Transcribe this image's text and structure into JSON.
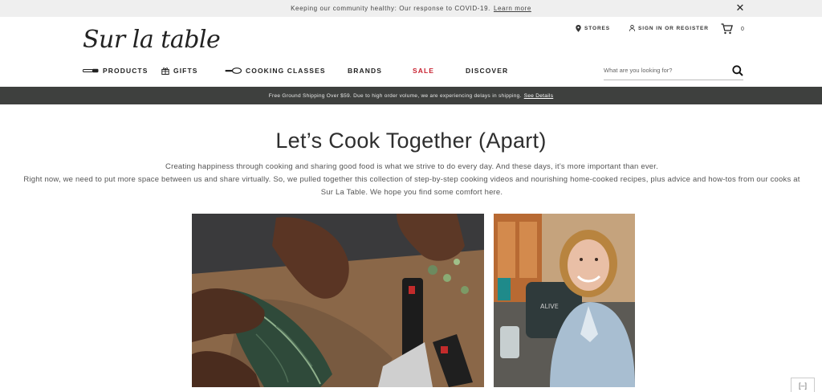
{
  "banner": {
    "text": "Keeping our community healthy: Our response to COVID-19.",
    "link": "Learn more"
  },
  "header": {
    "logo": "Sur la table",
    "stores": "STORES",
    "signin": "SIGN IN OR REGISTER",
    "cart_count": "0"
  },
  "nav": {
    "items": [
      {
        "label": "PRODUCTS",
        "icon": "knife-icon"
      },
      {
        "label": "GIFTS",
        "icon": "gift-icon"
      },
      {
        "label": "COOKING CLASSES",
        "icon": "pan-icon"
      },
      {
        "label": "BRANDS"
      },
      {
        "label": "SALE"
      },
      {
        "label": "DISCOVER"
      }
    ]
  },
  "search": {
    "placeholder": "What are you looking for?"
  },
  "shipping": {
    "text": "Free Ground Shipping Over $59. Due to high order volume, we are experiencing delays in shipping.",
    "link": "See Details"
  },
  "main": {
    "title": "Let’s Cook Together (Apart)",
    "intro_line1": "Creating happiness through cooking and sharing good food is what we strive to do every day. And these days, it’s more important than ever.",
    "intro_line2": "Right now, we need to put more space between us and share virtually. So, we pulled together this collection of step-by-step cooking videos and nourishing home-cooked recipes, plus advice and how-tos from our cooks at Sur La Table. We hope you find some comfort here."
  },
  "feedback": {
    "label": "[–]"
  },
  "colors": {
    "sale": "#c8202f",
    "shipbar_bg": "#3e403e",
    "topbar_bg": "#efefef"
  }
}
